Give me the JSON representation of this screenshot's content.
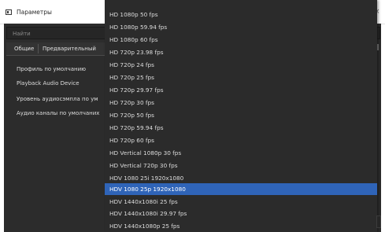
{
  "window": {
    "title": "Параметры"
  },
  "search": {
    "placeholder": "Найти"
  },
  "tabs": [
    {
      "label": "Общие"
    },
    {
      "label": "Предварительный"
    }
  ],
  "settings": [
    {
      "label": "Профиль по умолчанию"
    },
    {
      "label": "Playback Audio Device"
    },
    {
      "label": "Уровень аудиосэмпла по ум"
    },
    {
      "label": "Аудио каналы по умолчаних"
    }
  ],
  "dropdown": {
    "selected": "HDV 1080 25p 1920x1080",
    "options": [
      "HD 1080p 50 fps",
      "HD 1080p 59.94 fps",
      "HD 1080p 60 fps",
      "HD 720p 23.98 fps",
      "HD 720p 24 fps",
      "HD 720p 25 fps",
      "HD 720p 29.97 fps",
      "HD 720p 30 fps",
      "HD 720p 50 fps",
      "HD 720p 59.94 fps",
      "HD 720p 60 fps",
      "HD Vertical 1080p 30 fps",
      "HD Vertical 720p 30 fps",
      "HDV 1080 25i 1920x1080",
      "HDV 1080 25p 1920x1080",
      "HDV 1440x1080i 25 fps",
      "HDV 1440x1080i 29.97 fps",
      "HDV 1440x1080p 25 fps"
    ]
  },
  "colors": {
    "dialog_bg": "#2c2c2c",
    "dropdown_bg": "#2b2b2b",
    "selection": "#2f64b8",
    "text": "#dcdcdc"
  },
  "icons": {
    "app": "settings-window-icon",
    "close": "close-icon"
  }
}
